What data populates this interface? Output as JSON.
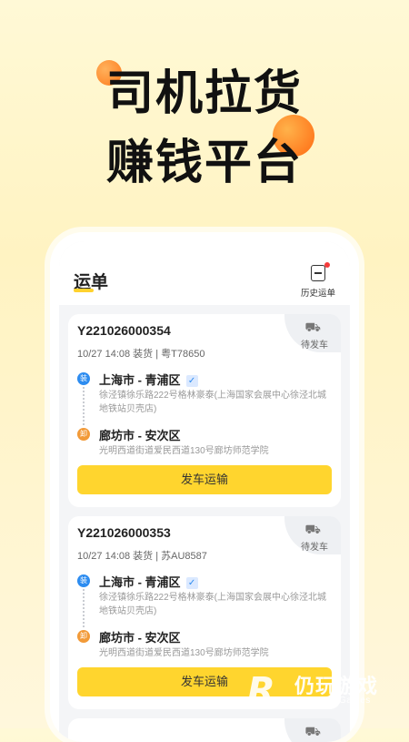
{
  "promo": {
    "line1": "司机拉货",
    "line2": "赚钱平台"
  },
  "app": {
    "title": "运单",
    "history_label": "历史运单",
    "orders": [
      {
        "order_no": "Y221026000354",
        "meta": "10/27 14:08 装货 | 粤T78650",
        "status": "待发车",
        "load_badge": "装",
        "load_city": "上海市 - 青浦区",
        "load_verified": "✓",
        "load_addr": "徐泾镇徐乐路222号格林豪泰(上海国家会展中心徐泾北城地铁站贝壳店)",
        "unload_badge": "卸",
        "unload_city": "廊坊市 - 安次区",
        "unload_addr": "光明西道街道爱民西道130号廊坊师范学院",
        "action": "发车运输"
      },
      {
        "order_no": "Y221026000353",
        "meta": "10/27 14:08 装货 | 苏AU8587",
        "status": "待发车",
        "load_badge": "装",
        "load_city": "上海市 - 青浦区",
        "load_verified": "✓",
        "load_addr": "徐泾镇徐乐路222号格林豪泰(上海国家会展中心徐泾北城地铁站贝壳店)",
        "unload_badge": "卸",
        "unload_city": "廊坊市 - 安次区",
        "unload_addr": "光明西道街道爱民西道130号廊坊师范学院",
        "action": "发车运输"
      }
    ]
  },
  "watermark": {
    "name": "仍玩游戏",
    "sub": "Rengwan Games"
  }
}
